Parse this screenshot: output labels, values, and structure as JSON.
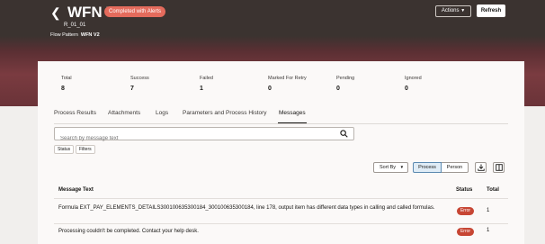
{
  "header": {
    "title": "WFN V2",
    "status_badge": "Completed with Alerts",
    "sub_id": "R_01_01",
    "flow_pattern_label": "Flow Pattern",
    "flow_pattern_value": "WFN V2",
    "actions_label": "Actions",
    "refresh_label": "Refresh"
  },
  "stats": [
    {
      "label": "Total",
      "value": "8"
    },
    {
      "label": "Success",
      "value": "7"
    },
    {
      "label": "Failed",
      "value": "1"
    },
    {
      "label": "Marked For Retry",
      "value": "0"
    },
    {
      "label": "Pending",
      "value": "0"
    },
    {
      "label": "Ignored",
      "value": "0"
    }
  ],
  "tabs": [
    {
      "label": "Process Results"
    },
    {
      "label": "Attachments"
    },
    {
      "label": "Logs"
    },
    {
      "label": "Parameters and Process History"
    },
    {
      "label": "Messages"
    }
  ],
  "active_tab": "Messages",
  "search": {
    "placeholder": "Search by message text"
  },
  "filters": {
    "status_label": "Status",
    "filters_label": "Filters"
  },
  "toolbar": {
    "sort_by_label": "Sort By",
    "process_label": "Process",
    "person_label": "Person"
  },
  "table": {
    "columns": [
      "Message Text",
      "Status",
      "Total"
    ],
    "rows": [
      {
        "text": "Formula EXT_PAY_ELEMENTS_DETAILS300100635300184_300100635300184, line 178, output item has different data types in calling and called formulas.",
        "status": "Error",
        "total": "1"
      },
      {
        "text": "Processing couldn't be completed. Contact your help desk.",
        "status": "Error",
        "total": "1"
      }
    ]
  },
  "colors": {
    "error": "#c74634",
    "badge": "#e46b5c",
    "selected": "#dfecf6"
  }
}
